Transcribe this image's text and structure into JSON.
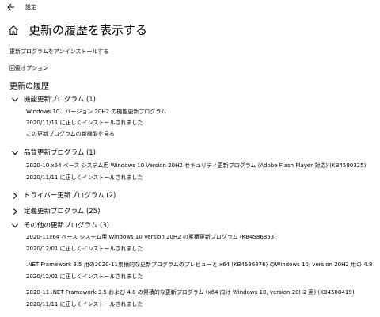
{
  "window": {
    "title": "設定"
  },
  "header": {
    "title": "更新の履歴を表示する"
  },
  "links": {
    "uninstall": "更新プログラムをアンインストールする",
    "recovery": "回復オプション"
  },
  "history": {
    "heading": "更新の履歴",
    "groups": [
      {
        "label": "機能更新プログラム (1)",
        "expanded": true,
        "lines": [
          "Windows 10、バージョン 20H2 の機能更新プログラム",
          "2020/11/11 に正しくインストールされました",
          "この更新プログラムの新機能を見る"
        ]
      },
      {
        "label": "品質更新プログラム (1)",
        "expanded": true,
        "lines": [
          "2020-10 x64 ベース システム用 Windows 10 Version 20H2 セキュリティ更新プログラム (Adobe Flash Player 対応) (KB4580325)",
          "2020/11/11 に正しくインストールされました"
        ]
      },
      {
        "label": "ドライバー更新プログラム (2)",
        "expanded": false,
        "lines": []
      },
      {
        "label": "定義更新プログラム (25)",
        "expanded": false,
        "lines": []
      },
      {
        "label": "その他の更新プログラム (3)",
        "expanded": true,
        "lines": [
          "2020-11x64 ベース システム用 Windows 10 Version 20H2 の累積更新プログラム (KB4586853)",
          "2020/12/01 に正しくインストールされました",
          ".NET Framework 3.5 用の2020-11累積的な更新プログラムのプレビューと x64 (KB4586876) のWindows 10, version 20H2 用の 4.8",
          "2020/12/01 に正しくインストールされました",
          "2020-11 .NET Framework 3.5 および 4.8 の累積的な更新プログラム (x64 向け Windows 10, version 20H2 用) (KB4580419)",
          "2020/11/11 に正しくインストールされました"
        ]
      }
    ]
  }
}
